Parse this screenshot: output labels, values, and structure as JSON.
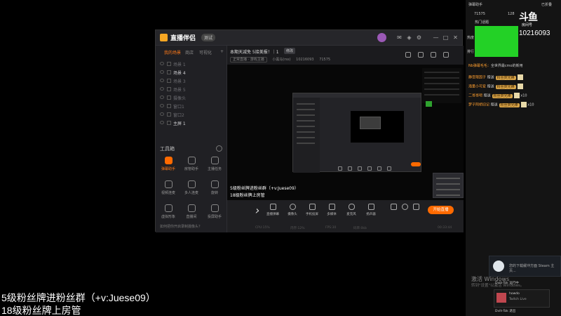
{
  "app": {
    "title": "直播伴侣",
    "badge": "测试",
    "win_controls": [
      "—",
      "□",
      "✕"
    ],
    "side_tabs": [
      "我的场景",
      "商店",
      "可视化"
    ],
    "scenes": [
      "场景 1",
      "场景 4",
      "场景 3",
      "场景 5",
      "摄像头",
      "窗口1",
      "窗口2",
      "主屏 1"
    ],
    "tools_title": "工具箱",
    "tools": [
      {
        "label": "弹幕助手",
        "hot": true
      },
      {
        "label": "房管助手",
        "hot": false
      },
      {
        "label": "主播任务",
        "hot": false
      },
      {
        "label": "视频连麦",
        "hot": false
      },
      {
        "label": "多人连麦",
        "hot": false
      },
      {
        "label": "旋转",
        "hot": false
      },
      {
        "label": "虚拟形象",
        "hot": false
      },
      {
        "label": "直播间",
        "hot": false
      },
      {
        "label": "投屏助手",
        "hot": false
      }
    ],
    "side_notice": "如何把你开启录制摄像头？",
    "room_title": "本期天减免 5接美报！｜1",
    "room_edit": "修改",
    "room_meta": [
      "正常直播 · 游戏主播",
      "小黑马(rss)",
      "10216093",
      "71575"
    ],
    "canvas_caption_1": "5级粉丝牌进粉丝群（+v:Juese09）",
    "canvas_caption_2": "18级粉丝牌上房管",
    "controls": [
      "直播弹幕",
      "摄像头",
      "手机投屏",
      "多媒体",
      "麦克风",
      "扬声器"
    ],
    "start_label": "开始直播",
    "status": [
      "CPU:15%",
      "内存:12%",
      "FPS:30",
      "码率:0kb",
      "00:33:44"
    ]
  },
  "chat": {
    "top_left": "弹幕助手",
    "top_right": "已折叠",
    "stat_views": "71575",
    "stat_fans": "128",
    "douyu_logo": "斗鱼",
    "douyu_sub": "房间号",
    "room_number": "10216093",
    "side_labels": [
      "热门话题",
      "热度",
      "排行"
    ],
    "lines": [
      {
        "name": "Nb弹幕毛毛：",
        "text": "全世界最cmo的新用",
        "tag": "",
        "gift": "",
        "count": ""
      },
      {
        "name": "静音限因子",
        "text": "赠送",
        "tag": "粉丝荧光棒",
        "gift": "g",
        "count": ""
      },
      {
        "name": "海量小可爱",
        "text": "赠送",
        "tag": "粉丝荧光棒",
        "gift": "g",
        "count": ""
      },
      {
        "name": "二哥哥吧",
        "text": "赠送",
        "tag": "粉丝荧光棒",
        "gift": "g",
        "count": "x10"
      },
      {
        "name": "梦子阿桥旧记",
        "text": "赠送",
        "tag": "粉丝荧光棒",
        "gift": "g",
        "count": "x10"
      }
    ],
    "toast_text": "您的下载缓冲方面 Steam 主页...",
    "activate_title": "激活 Windows",
    "activate_sub": "转到\"设置\"以激活 Windows。",
    "twitch_row1": "Dvih-Tok 运行中",
    "twitch_card_t1": "howdo",
    "twitch_card_t2": "Twitch Live",
    "twitch_row2": "Dvih-Tok 退出"
  },
  "overlay": {
    "line1": "5级粉丝牌进粉丝群（+v:Juese09）",
    "line2": "18级粉丝牌上房管"
  }
}
